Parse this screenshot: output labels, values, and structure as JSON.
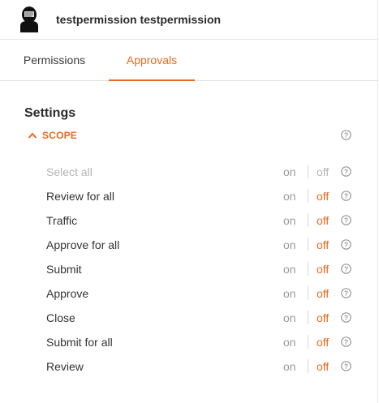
{
  "header": {
    "user_name": "testpermission testpermission",
    "avatar_icon": "user-avatar-icon"
  },
  "tabs": [
    {
      "label": "Permissions",
      "active": false
    },
    {
      "label": "Approvals",
      "active": true
    }
  ],
  "settings": {
    "title": "Settings",
    "scope": {
      "label": "SCOPE",
      "expanded": true
    },
    "items": [
      {
        "label": "Select all",
        "on": "on",
        "off": "off",
        "disabled": true,
        "value": "off"
      },
      {
        "label": "Review for all",
        "on": "on",
        "off": "off",
        "disabled": false,
        "value": "off"
      },
      {
        "label": "Traffic",
        "on": "on",
        "off": "off",
        "disabled": false,
        "value": "off"
      },
      {
        "label": "Approve for all",
        "on": "on",
        "off": "off",
        "disabled": false,
        "value": "off"
      },
      {
        "label": "Submit",
        "on": "on",
        "off": "off",
        "disabled": false,
        "value": "off"
      },
      {
        "label": "Approve",
        "on": "on",
        "off": "off",
        "disabled": false,
        "value": "off"
      },
      {
        "label": "Close",
        "on": "on",
        "off": "off",
        "disabled": false,
        "value": "off"
      },
      {
        "label": "Submit for all",
        "on": "on",
        "off": "off",
        "disabled": false,
        "value": "off"
      },
      {
        "label": "Review",
        "on": "on",
        "off": "off",
        "disabled": false,
        "value": "off"
      }
    ]
  },
  "colors": {
    "accent": "#e86a1f",
    "disabled_text": "#b5b5b5",
    "muted_text": "#9a9a9a"
  }
}
